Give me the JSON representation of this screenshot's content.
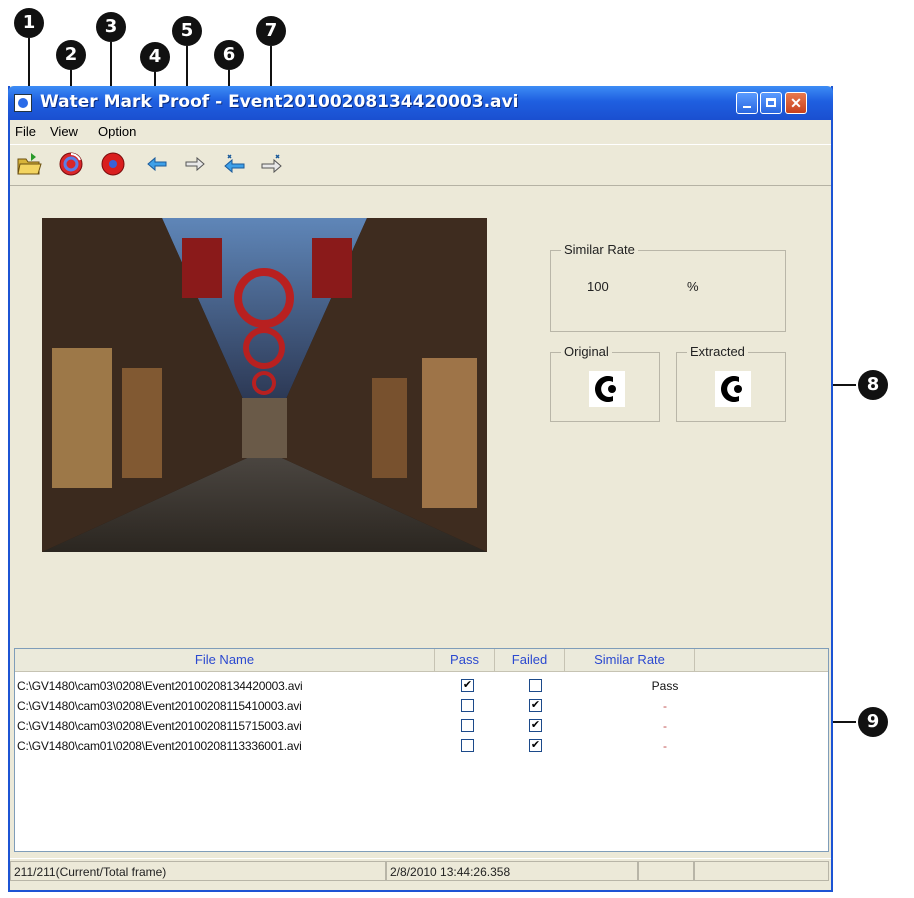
{
  "callouts": {
    "c1": "1",
    "c2": "2",
    "c3": "3",
    "c4": "4",
    "c5": "5",
    "c6": "6",
    "c7": "7",
    "c8": "8",
    "c9": "9"
  },
  "window": {
    "title": "Water Mark Proof - Event20100208134420003.avi"
  },
  "menu": {
    "file": "File",
    "view": "View",
    "option": "Option"
  },
  "toolbar": {
    "icons": [
      "open-folder-icon",
      "verify-icon",
      "stop-icon",
      "previous-icon",
      "next-icon",
      "first-icon",
      "last-icon"
    ]
  },
  "similar_rate": {
    "label": "Similar Rate",
    "value": "100",
    "unit": "%"
  },
  "watermark": {
    "original_label": "Original",
    "extracted_label": "Extracted"
  },
  "list": {
    "columns": {
      "file_name": "File Name",
      "pass": "Pass",
      "failed": "Failed",
      "similar_rate": "Similar Rate"
    },
    "rows": [
      {
        "path": "C:\\GV1480\\cam03\\0208\\Event20100208134420003.avi",
        "pass": "✔",
        "failed": "",
        "rate": "Pass"
      },
      {
        "path": "C:\\GV1480\\cam03\\0208\\Event20100208115410003.avi",
        "pass": "",
        "failed": "✔",
        "rate": "-"
      },
      {
        "path": "C:\\GV1480\\cam03\\0208\\Event20100208115715003.avi",
        "pass": "",
        "failed": "✔",
        "rate": "-"
      },
      {
        "path": "C:\\GV1480\\cam01\\0208\\Event20100208113336001.avi",
        "pass": "",
        "failed": "✔",
        "rate": "-"
      }
    ]
  },
  "status": {
    "frame": "211/211(Current/Total frame)",
    "timestamp": "2/8/2010 13:44:26.358"
  },
  "colors": {
    "titlebar": "#1f5fe0",
    "header_text": "#2b49d0",
    "window_bg": "#ece9d8"
  }
}
